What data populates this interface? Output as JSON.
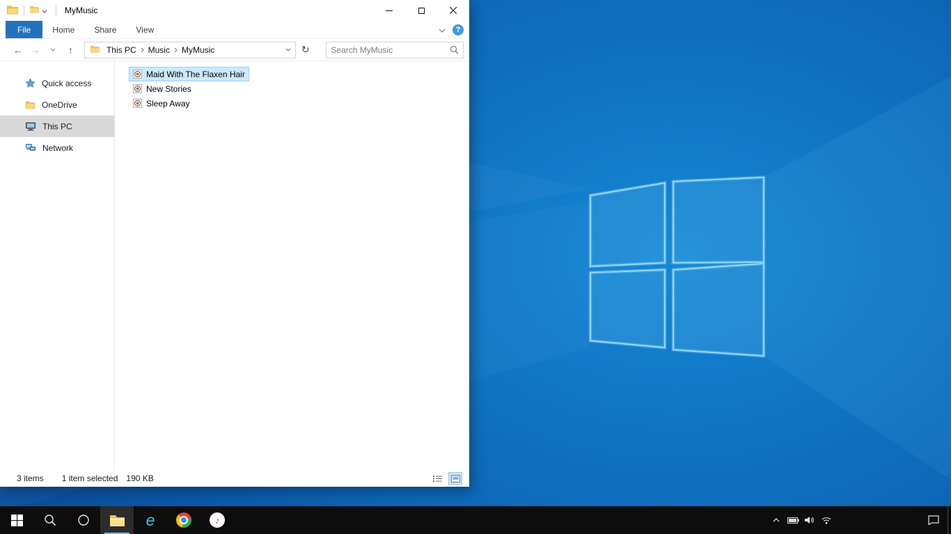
{
  "icons": {
    "back": "←",
    "forward": "→",
    "up": "↑",
    "refresh": "↻",
    "note": "♪",
    "ie_glyph": "e"
  },
  "explorer": {
    "title": "MyMusic",
    "ribbon": {
      "tabs": [
        {
          "label": "File",
          "active": true
        },
        {
          "label": "Home",
          "active": false
        },
        {
          "label": "Share",
          "active": false
        },
        {
          "label": "View",
          "active": false
        }
      ],
      "help_glyph": "?"
    },
    "address": {
      "breadcrumb": [
        "This PC",
        "Music",
        "MyMusic"
      ],
      "search_placeholder": "Search MyMusic"
    },
    "sidebar": {
      "items": [
        {
          "label": "Quick access"
        },
        {
          "label": "OneDrive"
        },
        {
          "label": "This PC",
          "selected": true
        },
        {
          "label": "Network"
        }
      ]
    },
    "files": [
      {
        "name": "Maid With The Flaxen Hair",
        "selected": true
      },
      {
        "name": "New Stories",
        "selected": false
      },
      {
        "name": "Sleep Away",
        "selected": false
      }
    ],
    "status": {
      "count": "3 items",
      "selection": "1 item selected",
      "size": "190 KB"
    }
  },
  "taskbar": {
    "buttons": [
      "start",
      "search",
      "cortana",
      "file-explorer",
      "internet-explorer",
      "chrome",
      "itunes"
    ],
    "tray": [
      "hidden-icons",
      "battery",
      "volume",
      "network",
      "action-center",
      "show-desktop"
    ],
    "active_button": "file-explorer"
  },
  "colors": {
    "selection_bg": "#cce8ff",
    "selection_border": "#99d1ff",
    "file_tab_blue": "#2173bd",
    "taskbar": "#0d0d0d"
  }
}
